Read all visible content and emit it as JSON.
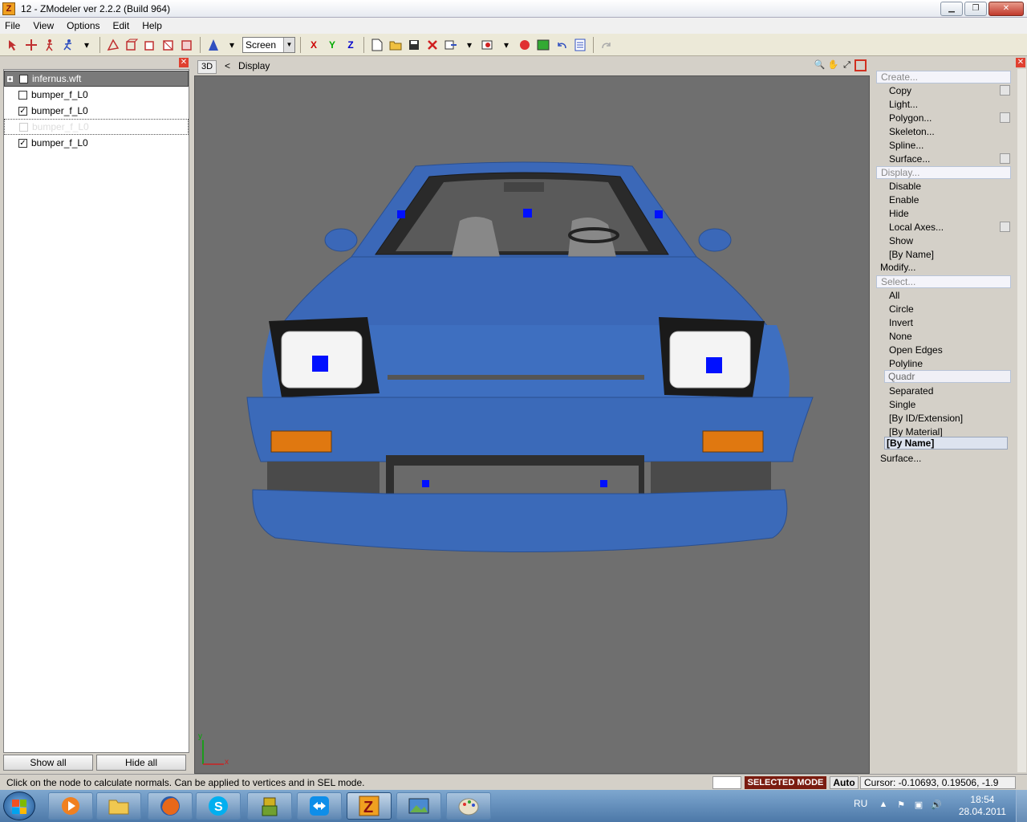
{
  "window": {
    "title": "12 - ZModeler ver 2.2.2 (Build 964)",
    "icon_letter": "Z",
    "minimize": "▁",
    "maximize": "❐",
    "close": "✕"
  },
  "menu": [
    "File",
    "View",
    "Options",
    "Edit",
    "Help"
  ],
  "toolbar": {
    "view_select": "Screen",
    "axis_x": "X",
    "axis_y": "Y",
    "axis_z": "Z"
  },
  "left_panel": {
    "tree": [
      {
        "label": "infernus.wft",
        "checked": true,
        "state": "selected",
        "expander": "+"
      },
      {
        "label": "bumper_f_L0",
        "checked": false,
        "state": "normal"
      },
      {
        "label": "bumper_f_L0",
        "checked": true,
        "state": "normal"
      },
      {
        "label": "bumper_f_L0",
        "checked": false,
        "state": "ghost"
      },
      {
        "label": "bumper_f_L0",
        "checked": true,
        "state": "normal"
      }
    ],
    "show_all": "Show all",
    "hide_all": "Hide all"
  },
  "viewport": {
    "mode_label": "3D",
    "back_glyph": "<",
    "panel_name": "Display",
    "axis_labels": {
      "y": "y",
      "x": "x"
    }
  },
  "right_panel": {
    "create_header": "Create...",
    "create_items": [
      "Copy",
      "Light...",
      "Polygon...",
      "Skeleton...",
      "Spline...",
      "Surface..."
    ],
    "display_header": "Display...",
    "display_items": [
      "Disable",
      "Enable",
      "Hide",
      "Local Axes...",
      "Show",
      "[By Name]"
    ],
    "modify_header": "Modify...",
    "select_header": "Select...",
    "select_items": [
      "All",
      "Circle",
      "Invert",
      "None",
      "Open Edges",
      "Polyline",
      "Quadr",
      "Separated",
      "Single",
      "[By ID/Extension]",
      "[By Material]",
      "[By Name]"
    ],
    "surface_header": "Surface..."
  },
  "status": {
    "message": "Click on the node to calculate normals. Can be applied to vertices and in SEL mode.",
    "mode": "SELECTED MODE",
    "auto": "Auto",
    "cursor": "Cursor: -0.10693, 0.19506, -1.9"
  },
  "taskbar": {
    "language": "RU",
    "time": "18:54",
    "date": "28.04.2011"
  },
  "colors": {
    "car_body": "#3b68b8",
    "viewport_bg": "#6f6f6f",
    "selected_mode_bg": "#7a1c10",
    "vertex_marker": "#0010ff"
  }
}
